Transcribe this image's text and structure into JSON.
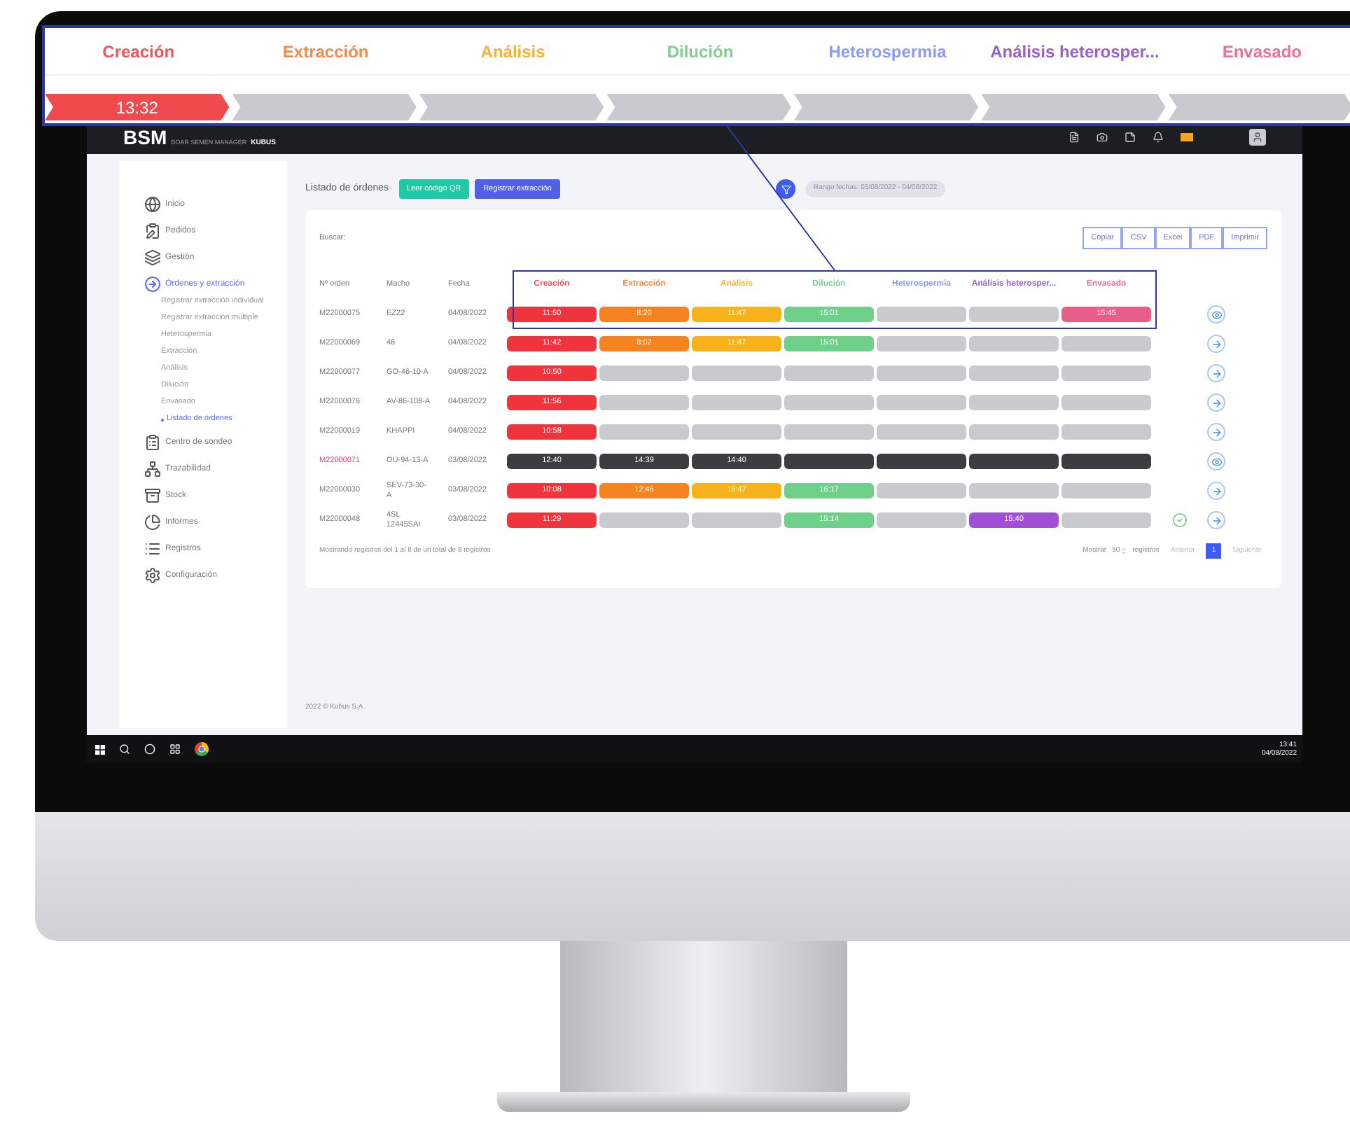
{
  "callout": {
    "stages": [
      {
        "label": "Creación",
        "color": "#f2545b"
      },
      {
        "label": "Extracción",
        "color": "#f5894a"
      },
      {
        "label": "Análisis",
        "color": "#f7b23b"
      },
      {
        "label": "Dilución",
        "color": "#7fcf8f"
      },
      {
        "label": "Heterospermia",
        "color": "#8c9cf0"
      },
      {
        "label": "Análisis heterosper...",
        "color": "#9b5fc8"
      },
      {
        "label": "Envasado",
        "color": "#ec6f98"
      }
    ],
    "timeline": [
      {
        "text": "13:32",
        "color": "#f04a4f"
      },
      {
        "color": "#c9cacd"
      },
      {
        "color": "#c9cacd"
      },
      {
        "color": "#c9cacd"
      },
      {
        "color": "#c9cacd"
      },
      {
        "color": "#c9cacd"
      },
      {
        "color": "#c9cacd"
      }
    ]
  },
  "header": {
    "logo": "BSM",
    "logo_sub": "BOAR SEMEN MANAGER",
    "logo_brand": "KUBUS"
  },
  "sidebar": {
    "items": [
      {
        "label": "Inicio",
        "expanded": false
      },
      {
        "label": "Pedidos",
        "expanded": false
      },
      {
        "label": "Gestión",
        "expanded": false
      },
      {
        "label": "Órdenes y extracción",
        "expanded": true,
        "children": [
          {
            "label": "Registrar extracción individual",
            "selected": false
          },
          {
            "label": "Registrar extracción múltiple",
            "selected": false
          },
          {
            "label": "Heterospermia",
            "selected": false
          },
          {
            "label": "Extracción",
            "selected": false
          },
          {
            "label": "Análisis",
            "selected": false
          },
          {
            "label": "Dilución",
            "selected": false
          },
          {
            "label": "Envasado",
            "selected": false
          },
          {
            "label": "Listado de órdenes",
            "selected": true
          }
        ]
      },
      {
        "label": "Centro de sondeo",
        "expanded": false
      },
      {
        "label": "Trazabilidad",
        "expanded": false
      },
      {
        "label": "Stock",
        "expanded": false
      },
      {
        "label": "Informes",
        "expanded": false
      },
      {
        "label": "Registros",
        "expanded": false
      },
      {
        "label": "Configuración",
        "expanded": false
      }
    ]
  },
  "toolbar": {
    "title": "Listado de órdenes",
    "buttons": [
      "Leer código QR",
      "Registrar extracción"
    ],
    "date_filter": "Rango fechas: 03/08/2022 - 04/08/2022"
  },
  "table": {
    "search_label": "Buscar:",
    "exports": [
      "Copiar",
      "CSV",
      "Excel",
      "PDF",
      "Imprimir"
    ],
    "columns": [
      "Nº orden",
      "Macho",
      "Fecha"
    ],
    "stage_columns": [
      {
        "label": "Creación",
        "color": "#f2545b"
      },
      {
        "label": "Extracción",
        "color": "#f5894a"
      },
      {
        "label": "Análisis",
        "color": "#f7b23b"
      },
      {
        "label": "Dilución",
        "color": "#7fcf8f"
      },
      {
        "label": "Heterospermia",
        "color": "#8c9cf0"
      },
      {
        "label": "Análisis heterosper...",
        "color": "#9b5fc8"
      },
      {
        "label": "Envasado",
        "color": "#ec6f98"
      }
    ],
    "rows": [
      {
        "order": "M22000075",
        "flagged": false,
        "macho": "EZ22",
        "fecha": "04/08/2022",
        "done": false,
        "kind": "view",
        "stages": [
          {
            "time": "11:50",
            "color": "#f0343d"
          },
          {
            "time": "8:20",
            "color": "#f5831f"
          },
          {
            "time": "11:47",
            "color": "#f9b21c"
          },
          {
            "time": "15:01",
            "color": "#6fd08a"
          },
          {
            "color": "#c9cacd"
          },
          {
            "color": "#c9cacd"
          },
          {
            "time": "15:45",
            "color": "#ea5d8b"
          }
        ]
      },
      {
        "order": "M22000069",
        "flagged": false,
        "macho": "48",
        "fecha": "04/08/2022",
        "done": false,
        "kind": "next",
        "stages": [
          {
            "time": "11:42",
            "color": "#f0343d"
          },
          {
            "time": "8:02",
            "color": "#f5831f"
          },
          {
            "time": "11:47",
            "color": "#f9b21c"
          },
          {
            "time": "15:01",
            "color": "#6fd08a"
          },
          {
            "color": "#c9cacd"
          },
          {
            "color": "#c9cacd"
          },
          {
            "color": "#c9cacd"
          }
        ]
      },
      {
        "order": "M22000077",
        "flagged": false,
        "macho": "GO-46-10-A",
        "fecha": "04/08/2022",
        "done": false,
        "kind": "next",
        "stages": [
          {
            "time": "10:50",
            "color": "#f0343d"
          },
          {
            "color": "#c9cacd"
          },
          {
            "color": "#c9cacd"
          },
          {
            "color": "#c9cacd"
          },
          {
            "color": "#c9cacd"
          },
          {
            "color": "#c9cacd"
          },
          {
            "color": "#c9cacd"
          }
        ]
      },
      {
        "order": "M22000076",
        "flagged": false,
        "macho": "AV-86-108-A",
        "fecha": "04/08/2022",
        "done": false,
        "kind": "next",
        "stages": [
          {
            "time": "11:56",
            "color": "#f0343d"
          },
          {
            "color": "#c9cacd"
          },
          {
            "color": "#c9cacd"
          },
          {
            "color": "#c9cacd"
          },
          {
            "color": "#c9cacd"
          },
          {
            "color": "#c9cacd"
          },
          {
            "color": "#c9cacd"
          }
        ]
      },
      {
        "order": "M22000019",
        "flagged": false,
        "macho": "KHAPPI",
        "fecha": "04/08/2022",
        "done": false,
        "kind": "next",
        "stages": [
          {
            "time": "10:58",
            "color": "#f0343d"
          },
          {
            "color": "#c9cacd"
          },
          {
            "color": "#c9cacd"
          },
          {
            "color": "#c9cacd"
          },
          {
            "color": "#c9cacd"
          },
          {
            "color": "#c9cacd"
          },
          {
            "color": "#c9cacd"
          }
        ]
      },
      {
        "order": "M22000071",
        "flagged": true,
        "macho": "OU-94-13-A",
        "fecha": "03/08/2022",
        "done": false,
        "kind": "view",
        "stages": [
          {
            "time": "12:40",
            "color": "#3c3d40"
          },
          {
            "time": "14:39",
            "color": "#3c3d40"
          },
          {
            "time": "14:40",
            "color": "#3c3d40"
          },
          {
            "color": "#3c3d40"
          },
          {
            "color": "#3c3d40"
          },
          {
            "color": "#3c3d40"
          },
          {
            "color": "#3c3d40"
          }
        ]
      },
      {
        "order": "M22000030",
        "flagged": false,
        "macho": "SEV-73-30-A",
        "fecha": "03/08/2022",
        "done": false,
        "kind": "next",
        "stages": [
          {
            "time": "10:08",
            "color": "#f0343d"
          },
          {
            "time": "12:46",
            "color": "#f5831f"
          },
          {
            "time": "15:47",
            "color": "#f9b21c"
          },
          {
            "time": "16:17",
            "color": "#6fd08a"
          },
          {
            "color": "#c9cacd"
          },
          {
            "color": "#c9cacd"
          },
          {
            "color": "#c9cacd"
          }
        ]
      },
      {
        "order": "M22000048",
        "flagged": false,
        "macho": "4SL 12445SAI",
        "fecha": "03/08/2022",
        "done": true,
        "kind": "next",
        "stages": [
          {
            "time": "11:29",
            "color": "#f0343d"
          },
          {
            "color": "#c9cacd"
          },
          {
            "color": "#c9cacd"
          },
          {
            "time": "15:14",
            "color": "#6fd08a"
          },
          {
            "color": "#c9cacd"
          },
          {
            "time": "15:40",
            "color": "#a04fd6"
          },
          {
            "color": "#c9cacd"
          }
        ]
      }
    ],
    "info": "Mostrando registros del 1 al 8 de un total de 8 registros",
    "show_label": "Mostrar",
    "page_size": "50",
    "records_label": "registros",
    "pages": [
      {
        "label": "Anterior",
        "selected": false
      },
      {
        "label": "1",
        "selected": true
      },
      {
        "label": "Siguiente",
        "selected": false
      }
    ]
  },
  "footer": "2022 © Kubus S.A.",
  "taskbar": {
    "time": "13:41",
    "date": "04/08/2022"
  }
}
